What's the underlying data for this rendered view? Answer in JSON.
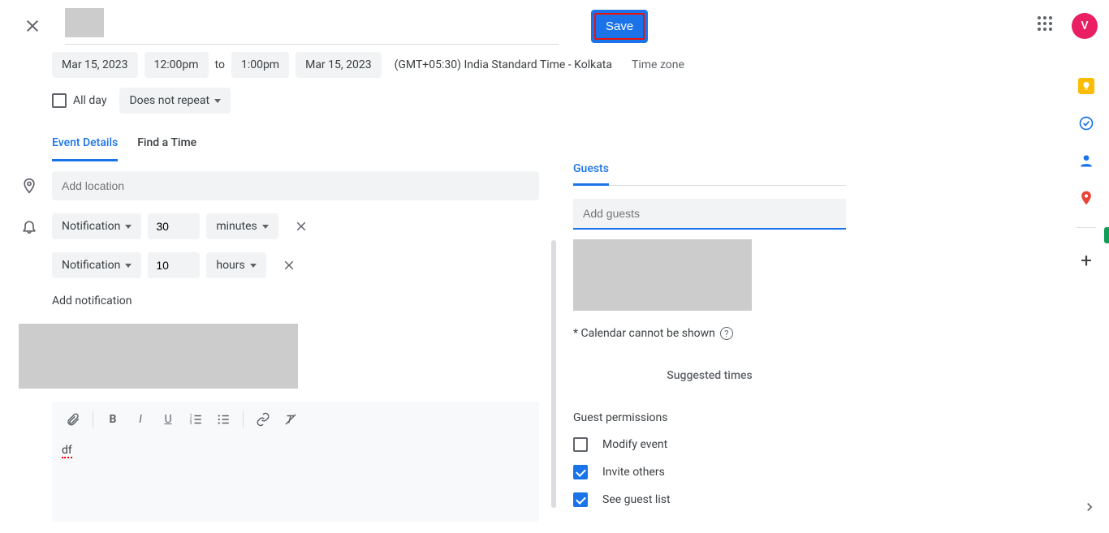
{
  "header": {
    "save_label": "Save",
    "avatar_initial": "V"
  },
  "datetime": {
    "start_date": "Mar 15, 2023",
    "start_time": "12:00pm",
    "to_label": "to",
    "end_time": "1:00pm",
    "end_date": "Mar 15, 2023",
    "timezone_text": "(GMT+05:30) India Standard Time - Kolkata",
    "timezone_link": "Time zone"
  },
  "options": {
    "all_day_label": "All day",
    "repeat_label": "Does not repeat"
  },
  "tabs": {
    "event_details": "Event Details",
    "find_time": "Find a Time"
  },
  "location": {
    "placeholder": "Add location"
  },
  "notifications": [
    {
      "type": "Notification",
      "value": "30",
      "unit": "minutes"
    },
    {
      "type": "Notification",
      "value": "10",
      "unit": "hours"
    }
  ],
  "add_notification_label": "Add notification",
  "editor": {
    "text": "df"
  },
  "guests": {
    "tab_label": "Guests",
    "placeholder": "Add guests",
    "calendar_note": "* Calendar cannot be shown",
    "suggested_label": "Suggested times",
    "permissions_title": "Guest permissions",
    "perm_modify": "Modify event",
    "perm_invite": "Invite others",
    "perm_see": "See guest list"
  }
}
